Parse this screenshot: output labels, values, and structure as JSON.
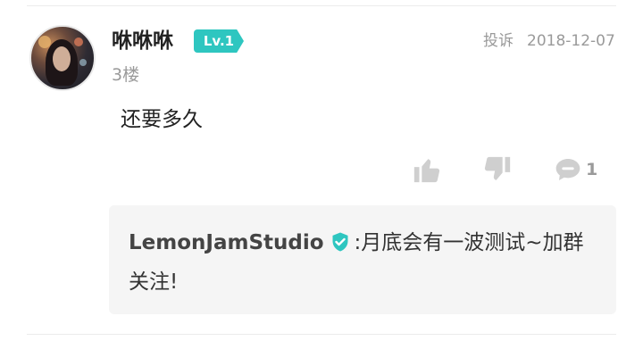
{
  "comment": {
    "username": "咻咻咻",
    "level": "Lv.1",
    "floor": "3楼",
    "report_label": "投诉",
    "date": "2018-12-07",
    "text": "还要多久",
    "reply_count": "1"
  },
  "icons": {
    "like": "thumbs-up-icon",
    "dislike": "thumbs-down-icon",
    "reply": "speech-bubble-icon",
    "verified": "verified-check-icon"
  },
  "reply": {
    "author": "LemonJamStudio",
    "separator": ":",
    "text": "月底会有一波测试~加群关注!"
  },
  "colors": {
    "level_badge": "#2ec6c0",
    "verified": "#2ec6c0",
    "icon_gray": "#cfcfcf",
    "text_secondary": "#9a9a9a"
  }
}
